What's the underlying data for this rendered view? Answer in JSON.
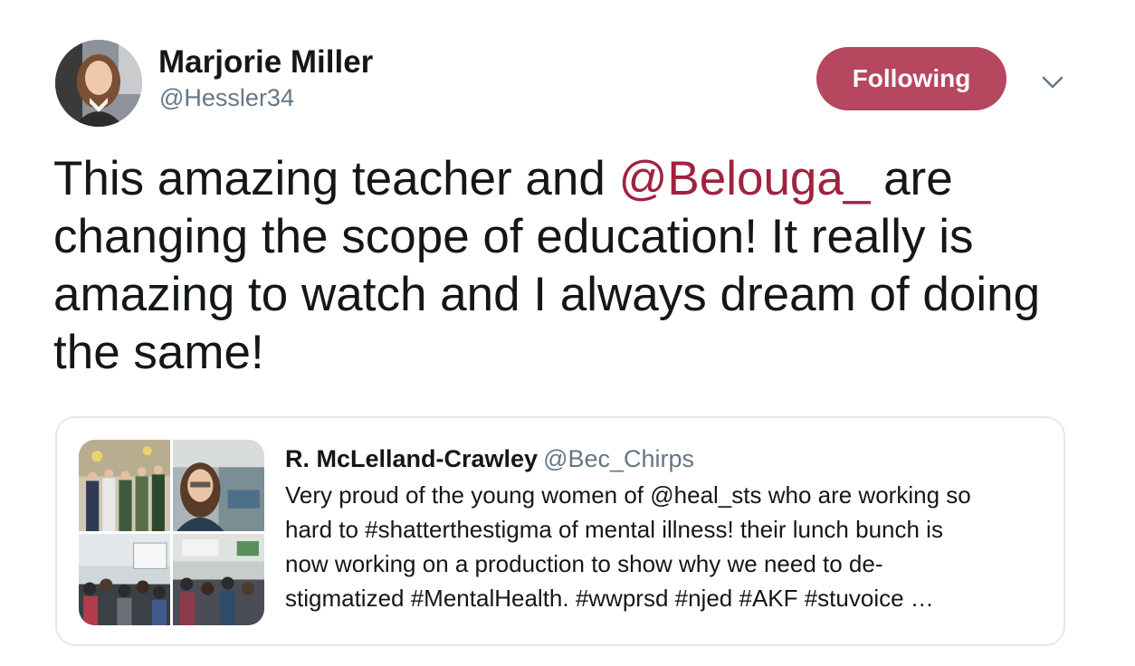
{
  "author": {
    "display_name": "Marjorie Miller",
    "handle": "@Hessler34"
  },
  "actions": {
    "follow_label": "Following",
    "menu_icon": "chevron-down-icon"
  },
  "tweet": {
    "text_before": "This amazing teacher and ",
    "mention": "@Belouga_",
    "text_after": " are changing the scope of education! It really is amazing to watch and I always dream of doing the same!"
  },
  "quote": {
    "display_name": "R. McLelland-Crawley",
    "handle": "@Bec_Chirps",
    "text": "Very proud of the young women of @heal_sts who are working so\nhard to #shatterthestigma of mental illness! their lunch bunch is\nnow working on a production to show why we need to de-\nstigmatized #MentalHealth.  #wwprsd #njed #AKF #stuvoice …"
  },
  "colors": {
    "follow_button": "#b5475f",
    "mention": "#a0223f",
    "secondary_text": "#657786",
    "card_border": "#e1e8ed"
  }
}
